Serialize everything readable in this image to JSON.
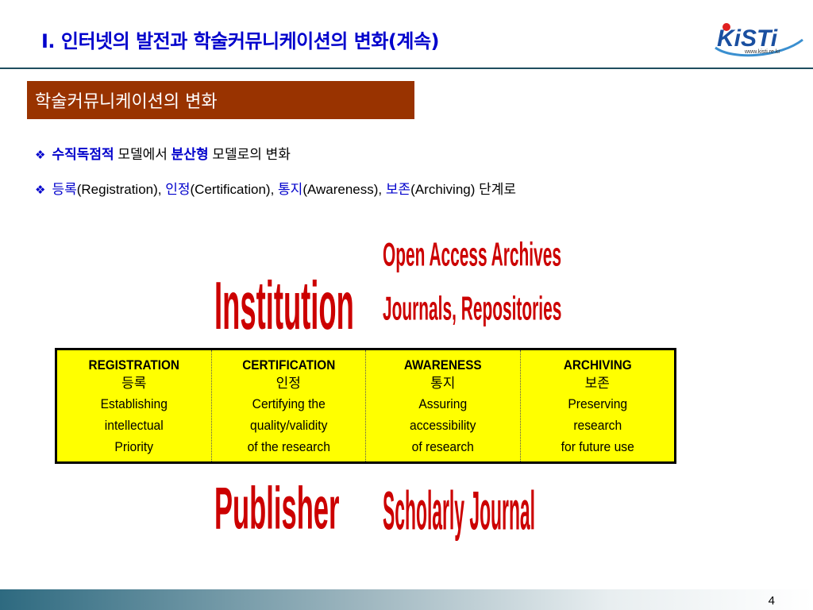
{
  "slide": {
    "title": "Ⅰ. 인터넷의 발전과 학술커뮤니케이션의 변화(계속)",
    "section_heading": "학술커뮤니케이션의 변화",
    "page_number": "4"
  },
  "logo": {
    "text": "KiSTi",
    "url_text": "www.kisti.re.kr"
  },
  "bullets": [
    {
      "mark": "❖",
      "parts": [
        "수직독점적",
        " 모델에서 ",
        "분산형",
        " 모델로의 변화"
      ]
    },
    {
      "mark": "❖",
      "parts": [
        "등록",
        "(Registration), ",
        "인정",
        "(Certification), ",
        "통지",
        "(Awareness), ",
        "보존",
        "(Archiving) 단계로"
      ]
    }
  ],
  "labels": {
    "open_access": "Open Access Archives",
    "journals_repos": "Journals, Repositories",
    "institution": "Institution",
    "publisher": "Publisher",
    "scholarly_journal": "Scholarly Journal"
  },
  "stages": [
    {
      "name": "REGISTRATION",
      "korean": "등록",
      "desc": [
        "Establishing",
        "intellectual",
        "Priority"
      ]
    },
    {
      "name": "CERTIFICATION",
      "korean": "인정",
      "desc": [
        "Certifying the",
        "quality/validity",
        "of the research"
      ]
    },
    {
      "name": "AWARENESS",
      "korean": "통지",
      "desc": [
        "Assuring",
        "accessibility",
        "of research"
      ]
    },
    {
      "name": "ARCHIVING",
      "korean": "보존",
      "desc": [
        "Preserving",
        "research",
        "for future use"
      ]
    }
  ],
  "colors": {
    "title_blue": "#0000cc",
    "section_brown": "#993300",
    "label_red": "#cc0000",
    "table_yellow": "#ffff00"
  }
}
